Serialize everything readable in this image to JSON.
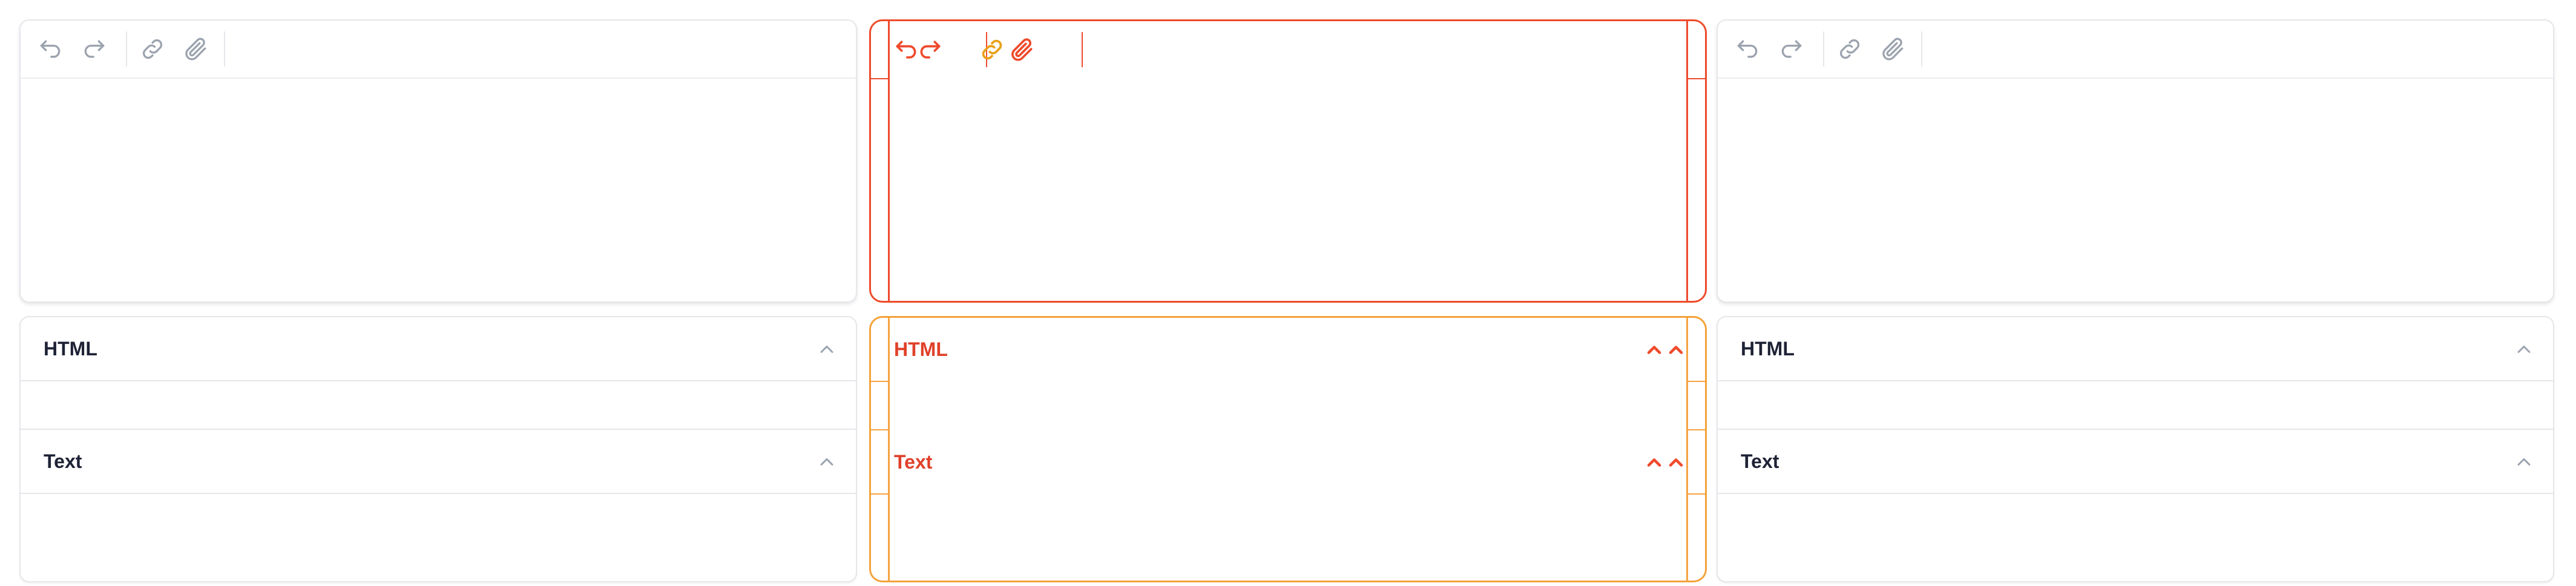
{
  "colors": {
    "icon": "#9ca3af",
    "border": "#e5e7eb",
    "title": "#1e2235",
    "highlight": "#ef4a2c",
    "highlight_alt": "#f4a23a"
  },
  "toolbar": {
    "buttons": [
      {
        "icon": "undo-icon"
      },
      {
        "icon": "redo-icon"
      },
      {
        "icon": "link-icon"
      },
      {
        "icon": "attachment-icon"
      }
    ]
  },
  "panels": [
    {
      "sections": [
        {
          "title": "HTML"
        },
        {
          "title": "Text"
        }
      ]
    },
    {
      "sections": [
        {
          "title": "HTML"
        },
        {
          "title": "Text"
        }
      ]
    },
    {
      "sections": [
        {
          "title": "HTML"
        },
        {
          "title": "Text"
        }
      ]
    }
  ]
}
